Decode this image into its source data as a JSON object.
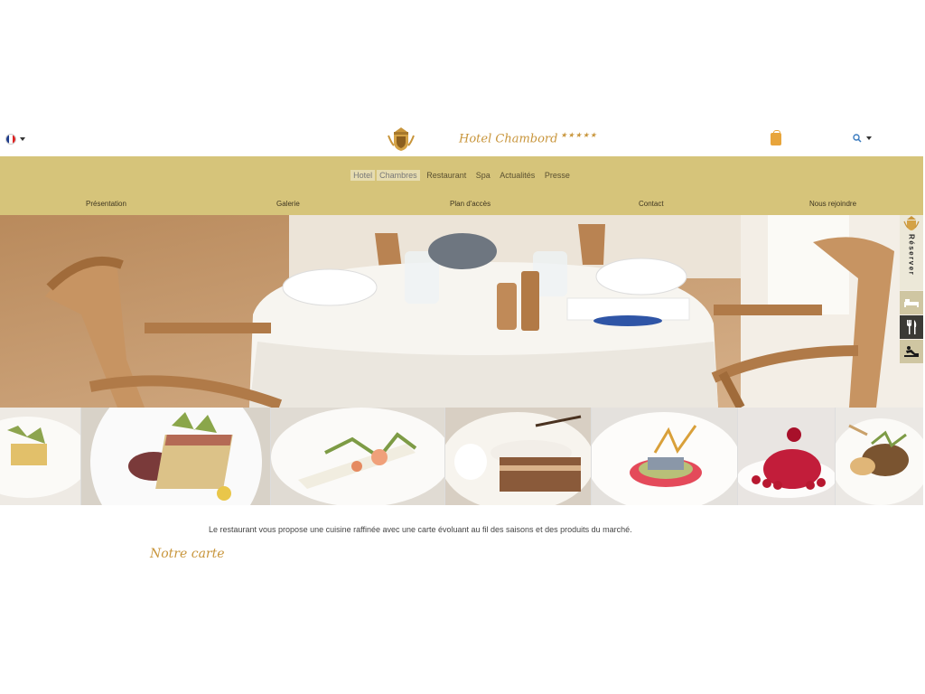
{
  "header": {
    "brand": "Hotel Chambord",
    "stars": "★★★★★",
    "language_flag": "fr-flag-icon",
    "search_icon": "search-icon",
    "cart_icon": "shopping-bag-icon"
  },
  "nav": {
    "top": [
      "Hotel",
      "Chambres",
      "Restaurant",
      "Spa",
      "Actualités",
      "Presse"
    ],
    "sub": [
      "Présentation",
      "Galerie",
      "Plan d'accès",
      "Contact",
      "Nous rejoindre"
    ]
  },
  "sidebar": {
    "reserve_label": "Réserver",
    "icons": [
      "bed-icon",
      "utensils-icon",
      "spa-icon"
    ]
  },
  "main": {
    "intro": "Le restaurant vous propose une cuisine raffinée avec une carte évoluant au fil des saisons et des produits du marché.",
    "carte_heading": "Notre carte"
  },
  "colors": {
    "nav_bg": "#d6c47a",
    "accent": "#c8953b"
  }
}
